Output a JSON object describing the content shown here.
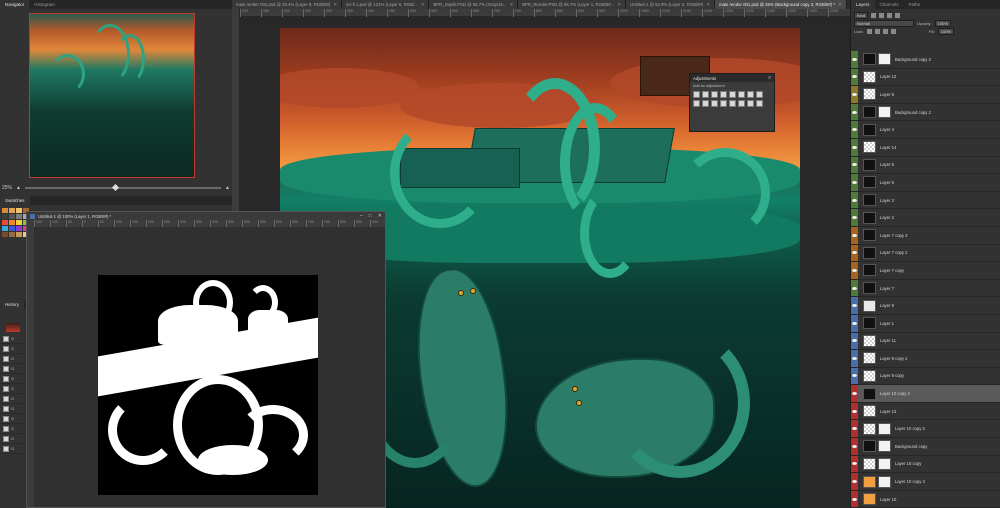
{
  "navigator": {
    "tabs": [
      "Navigator",
      "Histogram"
    ],
    "zoom": "25%",
    "zoom_fraction": 0.45
  },
  "swatches": {
    "tab": "Swatches",
    "colors": [
      "#d98a3a",
      "#e0a34f",
      "#f2c46a",
      "#a86a2c",
      "#3a3a3a",
      "#565656",
      "#7c7c7c",
      "#a8a8a8",
      "#e84a3c",
      "#f08a2c",
      "#f5d23a",
      "#8ac43a",
      "#3aa8d8",
      "#3a5ad8",
      "#8a3ad8",
      "#d83a9a",
      "#7a4a2a",
      "#9a6a3a",
      "#c89a5a",
      "#e8c88a"
    ]
  },
  "history": {
    "tab": "History",
    "items": [
      "G",
      "G",
      "G",
      "G",
      "G",
      "G",
      "G",
      "G",
      "G",
      "G",
      "G",
      "G"
    ]
  },
  "doc_tabs": [
    {
      "label": "main render 002.psd @ 29.4% (Layer 8, RGB/8#)",
      "active": false
    },
    {
      "label": "sci-fi 1.psd @ 121% (Layer 6, RGB/...",
      "active": false
    },
    {
      "label": "BPR_Depth.PSD @ 66.7% (Gray/16...",
      "active": false
    },
    {
      "label": "BPR_Render.PSD @ 66.7% (Layer 1, RGB/8#...",
      "active": false
    },
    {
      "label": "Untitled-1 @ 52.9% (Layer 2, RGB/8#)",
      "active": false
    },
    {
      "label": "main render 001.psd @ 25% (Background copy 3, RGB/8#) *",
      "active": true
    }
  ],
  "ruler_h": [
    "100",
    "150",
    "200",
    "250",
    "300",
    "350",
    "400",
    "450",
    "500",
    "550",
    "600",
    "650",
    "700",
    "750",
    "800",
    "850",
    "900",
    "950",
    "1000",
    "1050",
    "1100",
    "1150",
    "1200",
    "1250",
    "1300",
    "1350",
    "1400",
    "1450",
    "1500"
  ],
  "adjustments": {
    "title": "Adjustments",
    "subtitle": "Add an adjustment",
    "icons": [
      "brightness-icon",
      "levels-icon",
      "curves-icon",
      "exposure-icon",
      "vibrance-icon",
      "hue-saturation-icon",
      "color-balance-icon",
      "black-white-icon",
      "photo-filter-icon",
      "channel-mixer-icon",
      "color-lookup-icon",
      "invert-icon",
      "posterize-icon",
      "threshold-icon",
      "gradient-map-icon",
      "selective-color-icon"
    ]
  },
  "float_doc": {
    "title": "Untitled-1 @ 100% (Layer 1, RGB/8#) *",
    "ruler": [
      "150",
      "100",
      "50",
      "0",
      "50",
      "100",
      "150",
      "200",
      "250",
      "300",
      "350",
      "400",
      "450",
      "500",
      "550",
      "600",
      "650",
      "700",
      "750",
      "800",
      "850",
      "900"
    ]
  },
  "layers_panel": {
    "tabs": [
      "Layers",
      "Channels",
      "Paths"
    ],
    "filter_label": "Kind",
    "blend_mode": "Normal",
    "opacity_label": "Opacity:",
    "opacity_value": "100%",
    "lock_label": "Lock:",
    "fill_label": "Fill:",
    "fill_value": "100%",
    "layers": [
      {
        "name": "Background copy 3",
        "color": "#4f7a3a",
        "thumb": "dark",
        "mask": true,
        "selected": false
      },
      {
        "name": "Layer 12",
        "color": "#4f7a3a",
        "thumb": "trans",
        "mask": false,
        "selected": false
      },
      {
        "name": "Layer 8",
        "color": "#8a7a2a",
        "thumb": "trans",
        "mask": false,
        "selected": false
      },
      {
        "name": "Background copy 2",
        "color": "#4f7a3a",
        "thumb": "dark",
        "mask": true,
        "selected": false
      },
      {
        "name": "Layer 4",
        "color": "#4f7a3a",
        "thumb": "dark",
        "mask": false,
        "selected": false
      },
      {
        "name": "Layer 14",
        "color": "#4f7a3a",
        "thumb": "trans",
        "mask": false,
        "selected": false
      },
      {
        "name": "Layer 5",
        "color": "#4f7a3a",
        "thumb": "dark",
        "mask": false,
        "selected": false
      },
      {
        "name": "Layer 6",
        "color": "#4f7a3a",
        "thumb": "dark",
        "mask": false,
        "selected": false
      },
      {
        "name": "Layer 3",
        "color": "#4f7a3a",
        "thumb": "dark",
        "mask": false,
        "selected": false
      },
      {
        "name": "Layer 2",
        "color": "#4f7a3a",
        "thumb": "dark",
        "mask": false,
        "selected": false
      },
      {
        "name": "Layer 7 copy 3",
        "color": "#a8641e",
        "thumb": "dark",
        "mask": false,
        "selected": false
      },
      {
        "name": "Layer 7 copy 2",
        "color": "#a8641e",
        "thumb": "dark",
        "mask": false,
        "selected": false
      },
      {
        "name": "Layer 7 copy",
        "color": "#a8641e",
        "thumb": "dark",
        "mask": false,
        "selected": false
      },
      {
        "name": "Layer 7",
        "color": "#4f7a3a",
        "thumb": "dark",
        "mask": false,
        "selected": false
      },
      {
        "name": "Layer 9",
        "color": "#4a6ea8",
        "thumb": "light",
        "mask": false,
        "selected": false
      },
      {
        "name": "Layer 1",
        "color": "#4a6ea8",
        "thumb": "dark",
        "mask": false,
        "selected": false
      },
      {
        "name": "Layer 11",
        "color": "#4a6ea8",
        "thumb": "trans",
        "mask": false,
        "selected": false
      },
      {
        "name": "Layer 8 copy 2",
        "color": "#4a6ea8",
        "thumb": "trans",
        "mask": false,
        "selected": false
      },
      {
        "name": "Layer 8 copy",
        "color": "#4a6ea8",
        "thumb": "trans",
        "mask": false,
        "selected": false
      },
      {
        "name": "Layer 10 copy 4",
        "color": "#b03030",
        "thumb": "dark",
        "mask": false,
        "selected": true
      },
      {
        "name": "Layer 13",
        "color": "#b03030",
        "thumb": "trans",
        "mask": false,
        "selected": false
      },
      {
        "name": "Layer 10 copy 2",
        "color": "#b03030",
        "thumb": "trans",
        "mask": true,
        "selected": false
      },
      {
        "name": "Background copy",
        "color": "#b03030",
        "thumb": "dark",
        "mask": true,
        "selected": false
      },
      {
        "name": "Layer 10 copy",
        "color": "#b03030",
        "thumb": "trans",
        "mask": true,
        "selected": false
      },
      {
        "name": "Layer 10 copy 3",
        "color": "#b03030",
        "thumb": "orange",
        "mask": true,
        "selected": false
      },
      {
        "name": "Layer 10",
        "color": "#b03030",
        "thumb": "orange",
        "mask": false,
        "selected": false
      }
    ]
  }
}
